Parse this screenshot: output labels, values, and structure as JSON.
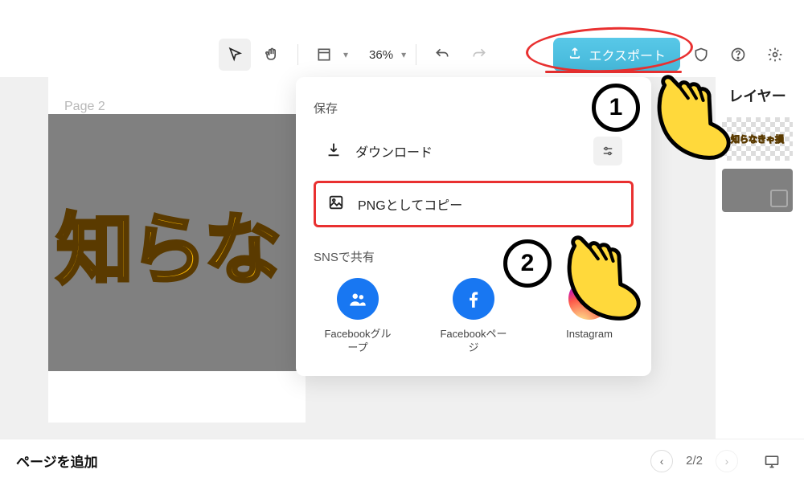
{
  "toolbar": {
    "zoom": "36%",
    "export_label": "エクスポート"
  },
  "canvas": {
    "page_label": "Page 2",
    "artwork_text": "知らな"
  },
  "right_panel": {
    "title": "レイヤー",
    "thumb1_text": "知らなきゃ損"
  },
  "popover": {
    "save_title": "保存",
    "download_label": "ダウンロード",
    "copy_png_label": "PNGとしてコピー",
    "share_title": "SNSで共有",
    "share": [
      {
        "label": "Facebookグループ"
      },
      {
        "label": "Facebookページ"
      },
      {
        "label": "Instagram"
      }
    ]
  },
  "footer": {
    "add_page": "ページを追加",
    "page_indicator": "2/2"
  },
  "annotations": {
    "step1": "1",
    "step2": "2"
  }
}
